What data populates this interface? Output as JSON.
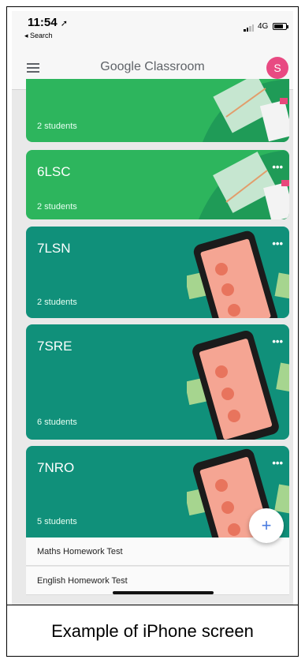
{
  "status_bar": {
    "time": "11:54",
    "location_glyph": "➚",
    "back_label": "◂ Search",
    "network": "4G"
  },
  "app_bar": {
    "title": "Google Classroom",
    "avatar_initial": "S",
    "menu_icon": "hamburger-menu-icon"
  },
  "classes": [
    {
      "name": "",
      "students": "2 students",
      "theme": "green"
    },
    {
      "name": "6LSC",
      "students": "2 students",
      "theme": "green"
    },
    {
      "name": "7LSN",
      "students": "2 students",
      "theme": "teal"
    },
    {
      "name": "7SRE",
      "students": "6 students",
      "theme": "teal"
    },
    {
      "name": "7NRO",
      "students": "5 students",
      "theme": "teal"
    }
  ],
  "card_menu_glyph": "•••",
  "list_items": [
    "Maths Homework Test",
    "English Homework Test"
  ],
  "fab_glyph": "+",
  "caption": "Example of iPhone screen",
  "colors": {
    "green_card": "#2db55d",
    "teal_card": "#10907a",
    "avatar": "#e84a82",
    "fab_plus": "#4a7be0"
  }
}
